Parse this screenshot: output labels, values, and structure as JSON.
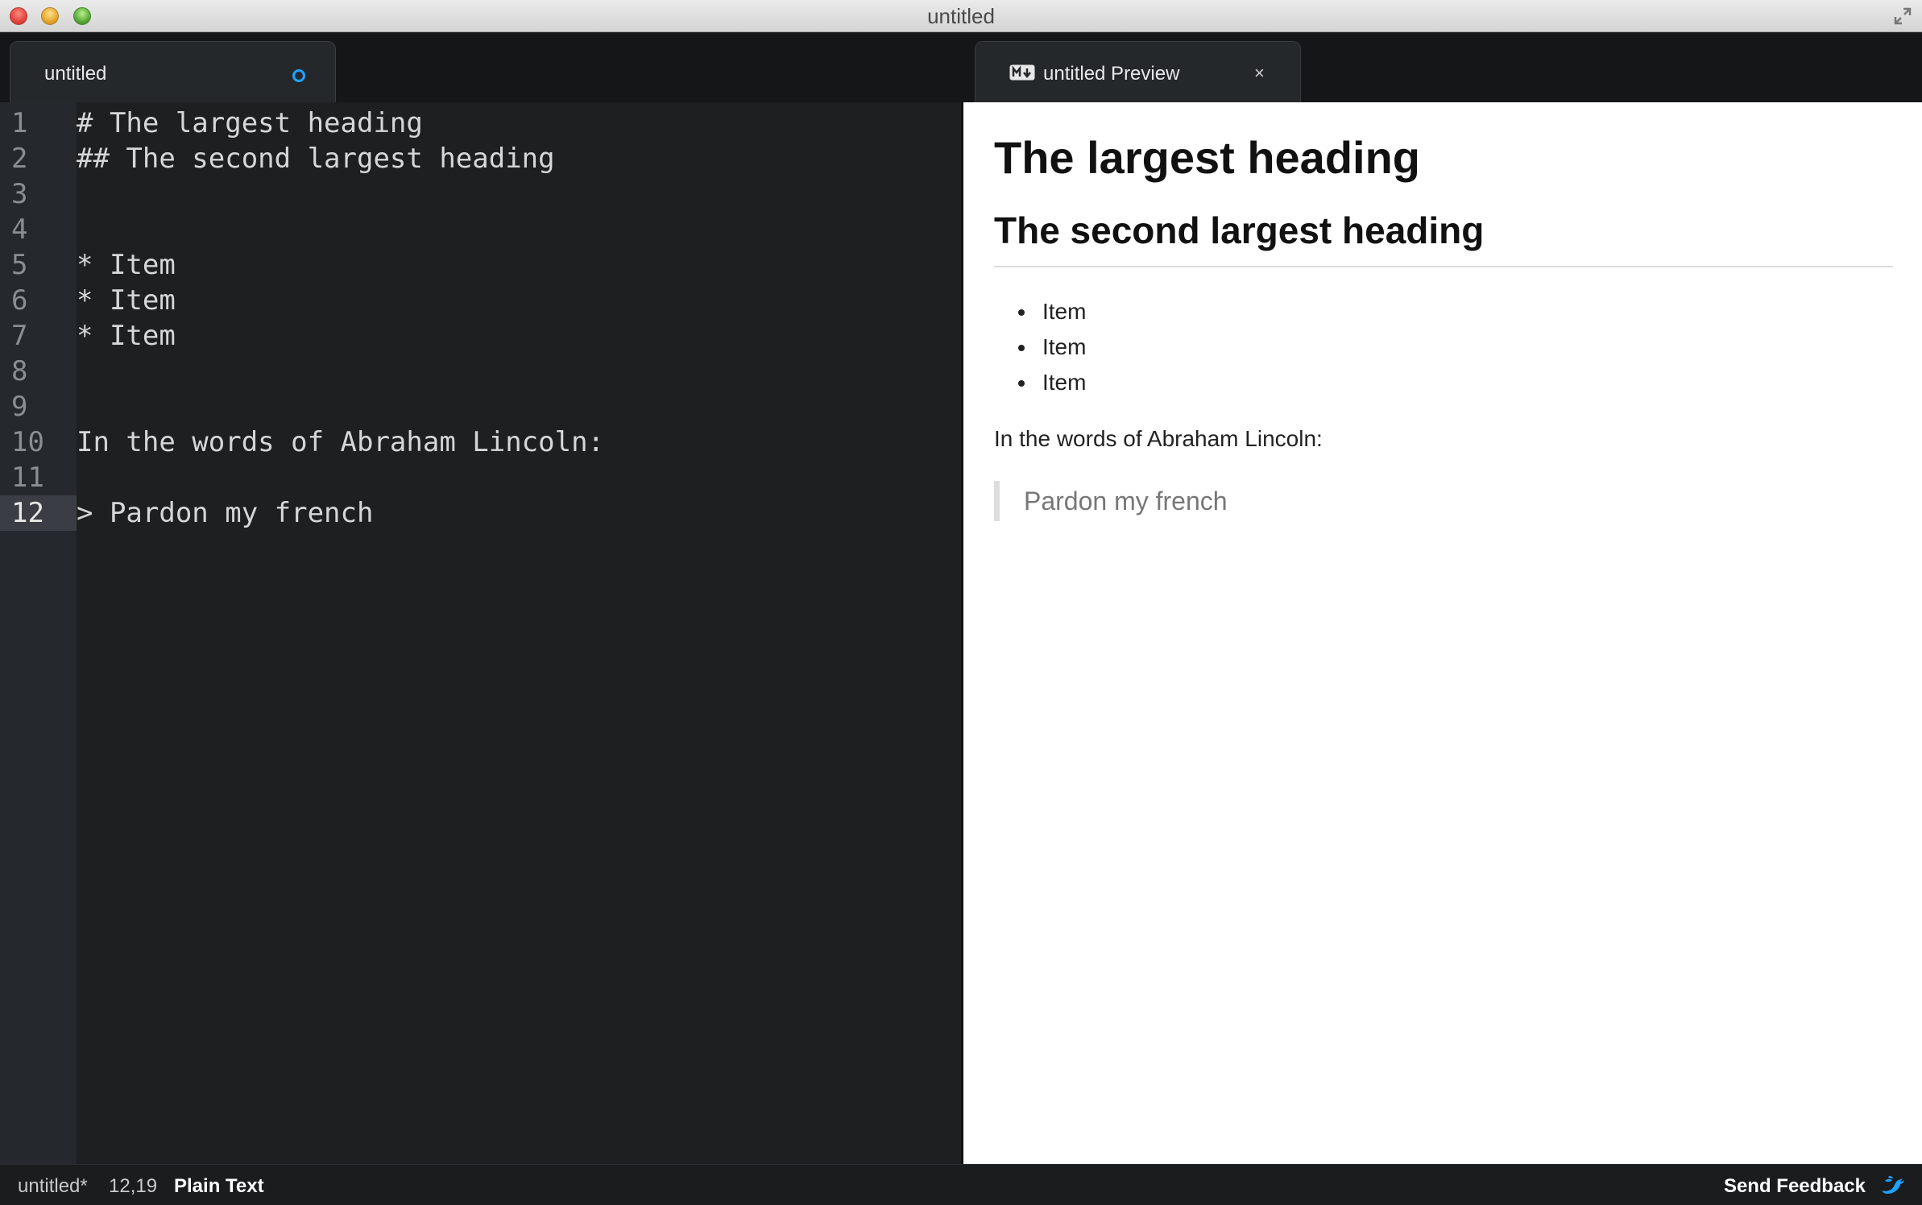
{
  "window": {
    "title": "untitled"
  },
  "tabs": [
    {
      "label": "untitled",
      "modified": true
    },
    {
      "label": "untitled Preview",
      "icon": "markdown-icon",
      "close_glyph": "×"
    }
  ],
  "editor": {
    "line_numbers": [
      "1",
      "2",
      "3",
      "4",
      "5",
      "6",
      "7",
      "8",
      "9",
      "10",
      "11",
      "12"
    ],
    "lines": [
      "# The largest heading",
      "## The second largest heading",
      "",
      "",
      "* Item",
      "* Item",
      "* Item",
      "",
      "",
      "In the words of Abraham Lincoln:",
      "",
      "> Pardon my french"
    ],
    "active_line": 12
  },
  "preview": {
    "h1": "The largest heading",
    "h2": "The second largest heading",
    "list_items": [
      "Item",
      "Item",
      "Item"
    ],
    "paragraph": "In the words of Abraham Lincoln:",
    "blockquote": "Pardon my french"
  },
  "status": {
    "file": "untitled*",
    "position": "12,19",
    "syntax": "Plain Text",
    "feedback": "Send Feedback",
    "feedback_icon": "bird-icon"
  },
  "colors": {
    "accent": "#1fa3ff",
    "editor_bg": "#1d1f21",
    "gutter_bg": "#25282c",
    "preview_bg": "#ffffff"
  }
}
